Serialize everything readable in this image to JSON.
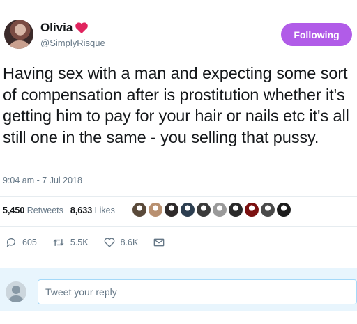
{
  "user": {
    "name": "Olivia",
    "handle": "@SimplyRisque",
    "name_emoji": "red-heart-icon"
  },
  "follow_button": {
    "label": "Following",
    "color": "#b15ce8"
  },
  "tweet": {
    "text": "Having sex with a man and expecting some sort of compensation after is prostitution whether it's getting him to pay for your hair or nails etc it's all still one in the same - you selling that pussy.",
    "timestamp": "9:04 am - 7 Jul 2018"
  },
  "stats": {
    "retweets_count": "5,450",
    "retweets_label": "Retweets",
    "likes_count": "8,633",
    "likes_label": "Likes",
    "liker_avatar_colors": [
      "#5a4a3a",
      "#b89070",
      "#2e2a2a",
      "#2c3e50",
      "#3a3a3a",
      "#9a9a9a",
      "#2a2a2a",
      "#7a1010",
      "#4a4a4a",
      "#1c1c1c"
    ]
  },
  "actions": {
    "reply_count": "605",
    "retweet_count": "5.5K",
    "like_count": "8.6K"
  },
  "reply": {
    "placeholder": "Tweet your reply"
  }
}
